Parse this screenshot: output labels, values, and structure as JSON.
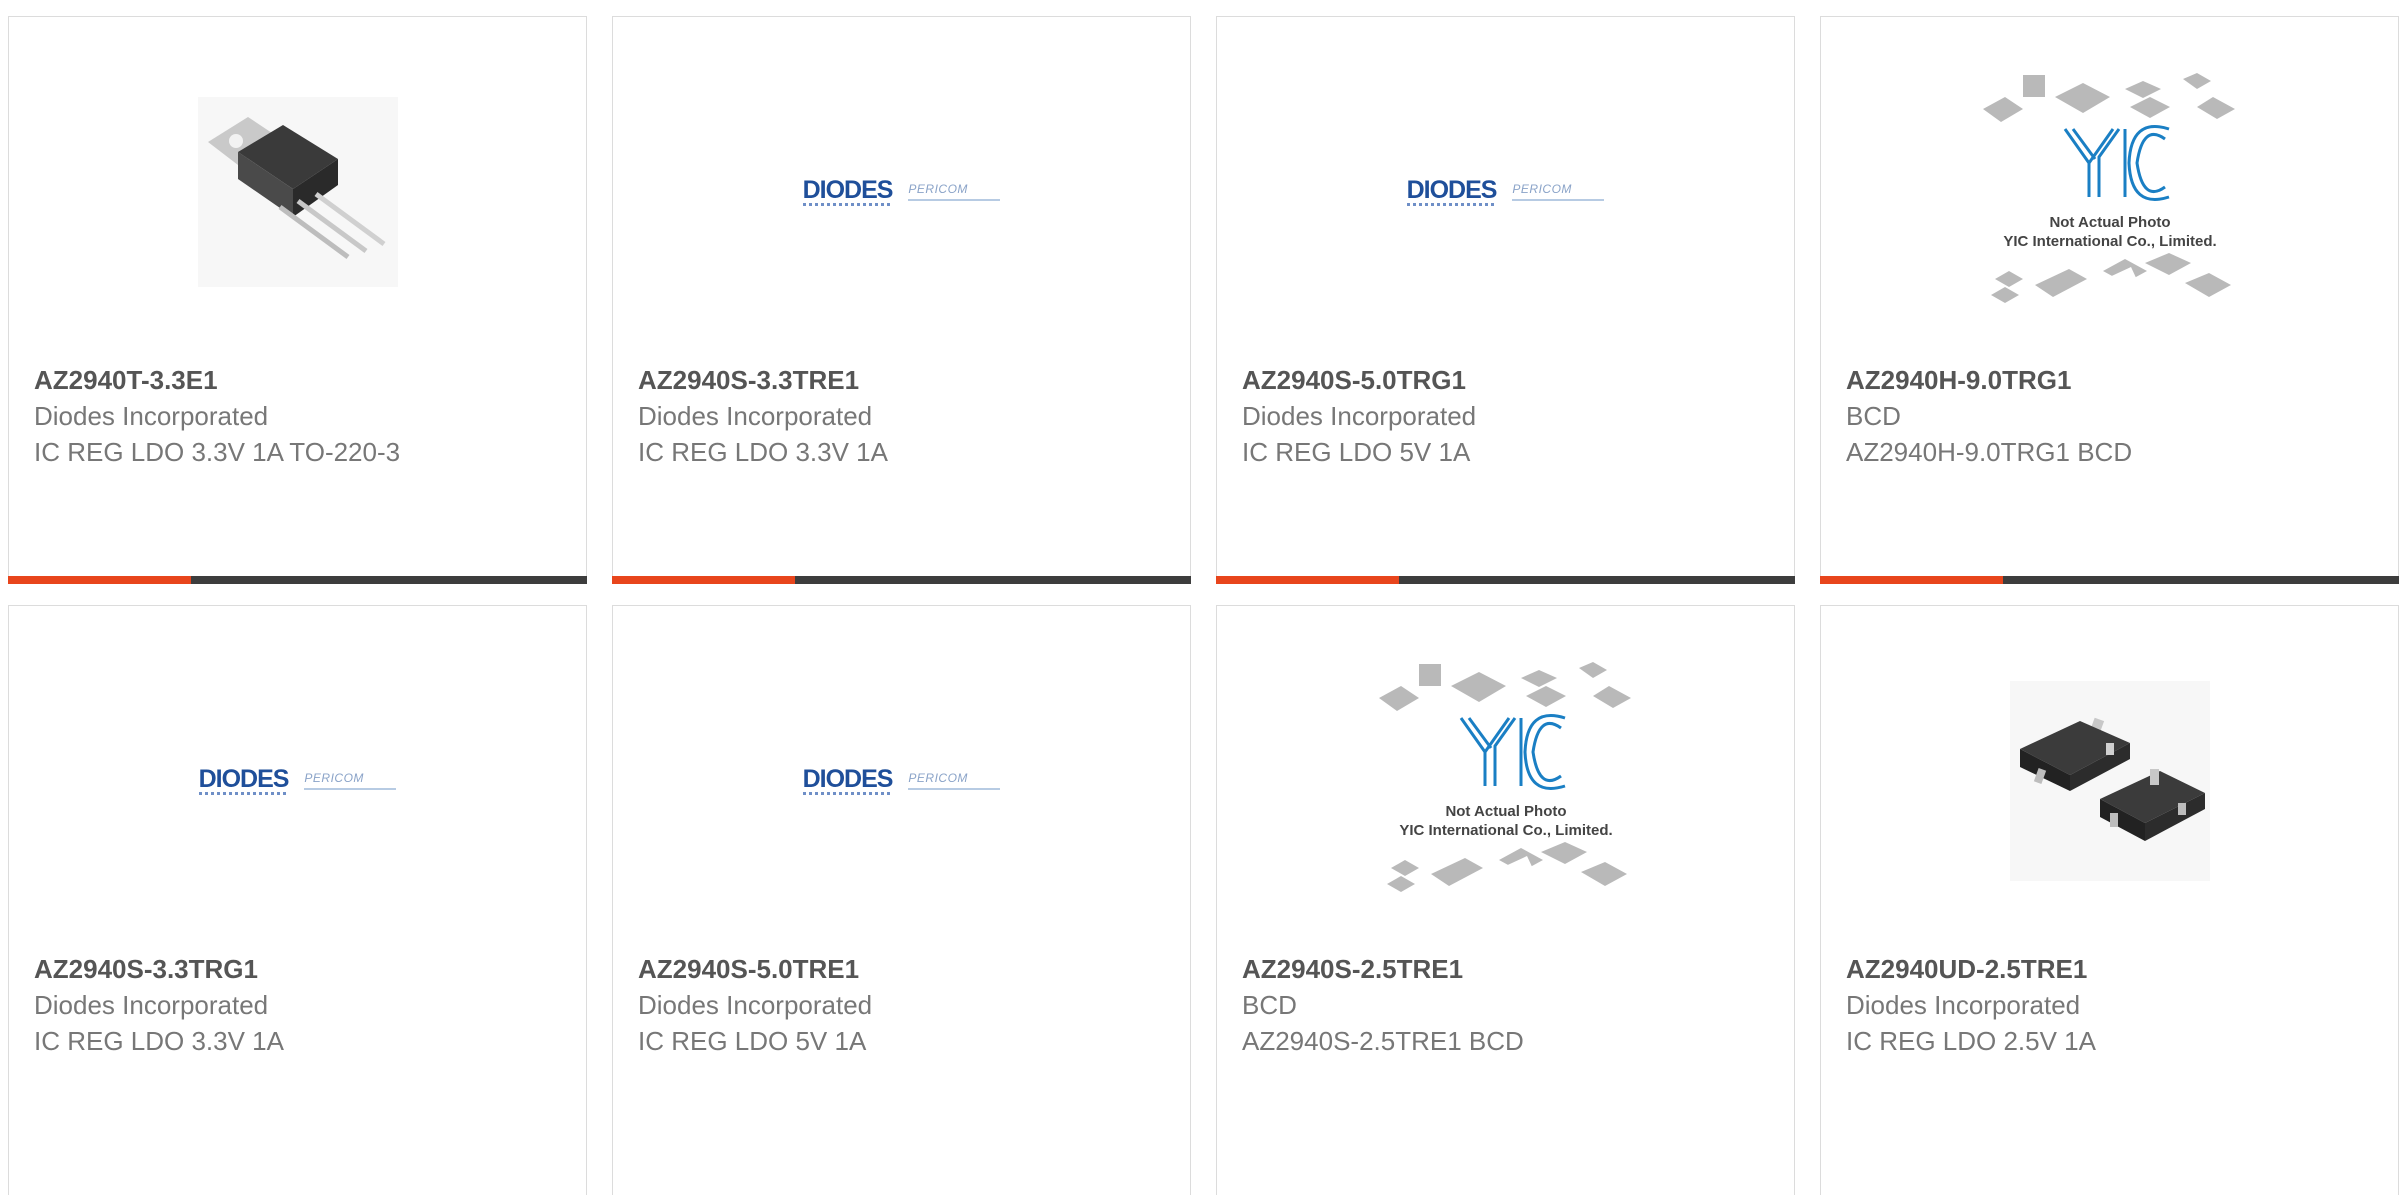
{
  "cards": [
    {
      "part": "AZ2940T-3.3E1",
      "manufacturer": "Diodes Incorporated",
      "description": "IC REG LDO 3.3V 1A TO-220-3",
      "image": "to220-transistor"
    },
    {
      "part": "AZ2940S-3.3TRE1",
      "manufacturer": "Diodes Incorporated",
      "description": "IC REG LDO 3.3V 1A",
      "image": "diodes-logo"
    },
    {
      "part": "AZ2940S-5.0TRG1",
      "manufacturer": "Diodes Incorporated",
      "description": "IC REG LDO 5V 1A",
      "image": "diodes-logo"
    },
    {
      "part": "AZ2940H-9.0TRG1",
      "manufacturer": "BCD",
      "description": "AZ2940H-9.0TRG1 BCD",
      "image": "yic-placeholder"
    },
    {
      "part": "AZ2940S-3.3TRG1",
      "manufacturer": "Diodes Incorporated",
      "description": "IC REG LDO 3.3V 1A",
      "image": "diodes-logo"
    },
    {
      "part": "AZ2940S-5.0TRE1",
      "manufacturer": "Diodes Incorporated",
      "description": "IC REG LDO 5V 1A",
      "image": "diodes-logo"
    },
    {
      "part": "AZ2940S-2.5TRE1",
      "manufacturer": "BCD",
      "description": "AZ2940S-2.5TRE1 BCD",
      "image": "yic-placeholder"
    },
    {
      "part": "AZ2940UD-2.5TRE1",
      "manufacturer": "Diodes Incorporated",
      "description": "IC REG LDO 2.5V 1A",
      "image": "sot23-package"
    }
  ],
  "logos": {
    "diodes_word": "DIODES",
    "pericom_word": "PERICOM",
    "yic_mark": "YIC",
    "yic_line1": "Not Actual Photo",
    "yic_line2": "YIC International Co., Limited."
  },
  "colors": {
    "accent": "#e8451c",
    "bar": "#3d3d3d",
    "diodes_blue": "#1f4f9a",
    "yic_blue": "#1a7fc4"
  }
}
